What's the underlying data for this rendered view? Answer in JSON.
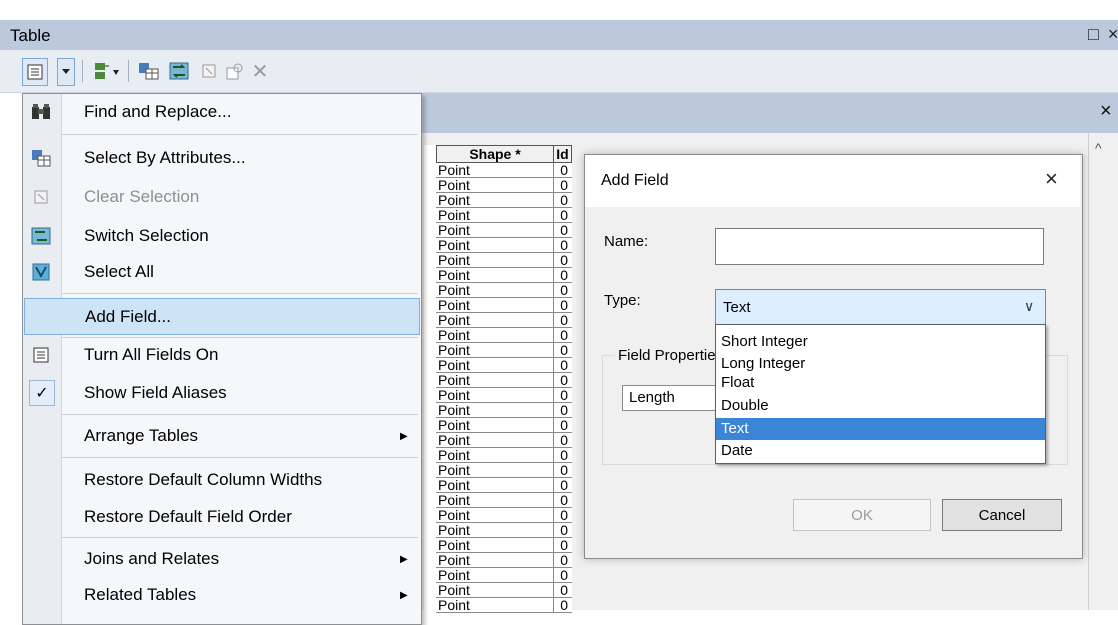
{
  "window": {
    "title": "Table",
    "controls": "□ ×",
    "subbar_close": "×"
  },
  "colors": {
    "titlebar": "#bcc8dc",
    "highlight": "#cde4f7",
    "selected_option": "#3a85d8"
  },
  "toolbar": {
    "icons": [
      "table-options-icon",
      "dropdown-arrow-icon",
      "related-tables-icon",
      "select-by-attributes-icon",
      "switch-selection-icon",
      "clear-selection-icon",
      "zoom-to-selected-icon",
      "delete-selected-icon"
    ]
  },
  "menu": {
    "items": [
      {
        "label": "Find and Replace...",
        "icon": "binoculars-icon",
        "enabled": true
      },
      {
        "label": "Select By Attributes...",
        "icon": "select-by-attributes-icon",
        "enabled": true
      },
      {
        "label": "Clear Selection",
        "icon": "clear-selection-icon",
        "enabled": false
      },
      {
        "label": "Switch Selection",
        "icon": "switch-selection-icon",
        "enabled": true
      },
      {
        "label": "Select All",
        "icon": "select-all-icon",
        "enabled": true
      },
      {
        "label": "Add Field...",
        "icon": "",
        "enabled": true,
        "highlighted": true
      },
      {
        "label": "Turn All Fields On",
        "icon": "fields-on-icon",
        "enabled": true
      },
      {
        "label": "Show Field Aliases",
        "icon": "checkmark-icon",
        "enabled": true,
        "checked": true
      },
      {
        "label": "Arrange Tables",
        "icon": "",
        "enabled": true,
        "submenu": true
      },
      {
        "label": "Restore Default Column Widths",
        "icon": "",
        "enabled": true
      },
      {
        "label": "Restore Default Field Order",
        "icon": "",
        "enabled": true
      },
      {
        "label": "Joins and Relates",
        "icon": "",
        "enabled": true,
        "submenu": true
      },
      {
        "label": "Related Tables",
        "icon": "",
        "enabled": true,
        "submenu": true
      }
    ]
  },
  "table": {
    "columns": [
      "Shape *",
      "Id"
    ],
    "rows": [
      [
        "Point",
        "0"
      ],
      [
        "Point",
        "0"
      ],
      [
        "Point",
        "0"
      ],
      [
        "Point",
        "0"
      ],
      [
        "Point",
        "0"
      ],
      [
        "Point",
        "0"
      ],
      [
        "Point",
        "0"
      ],
      [
        "Point",
        "0"
      ],
      [
        "Point",
        "0"
      ],
      [
        "Point",
        "0"
      ],
      [
        "Point",
        "0"
      ],
      [
        "Point",
        "0"
      ],
      [
        "Point",
        "0"
      ],
      [
        "Point",
        "0"
      ],
      [
        "Point",
        "0"
      ],
      [
        "Point",
        "0"
      ],
      [
        "Point",
        "0"
      ],
      [
        "Point",
        "0"
      ],
      [
        "Point",
        "0"
      ],
      [
        "Point",
        "0"
      ],
      [
        "Point",
        "0"
      ],
      [
        "Point",
        "0"
      ],
      [
        "Point",
        "0"
      ],
      [
        "Point",
        "0"
      ],
      [
        "Point",
        "0"
      ],
      [
        "Point",
        "0"
      ],
      [
        "Point",
        "0"
      ],
      [
        "Point",
        "0"
      ],
      [
        "Point",
        "0"
      ],
      [
        "Point",
        "0"
      ]
    ]
  },
  "dialog": {
    "title": "Add Field",
    "close": "×",
    "name_label": "Name:",
    "name_value": "",
    "type_label": "Type:",
    "type_value": "Text",
    "type_chevron": "∨",
    "field_properties_label": "Field Properties",
    "length_label": "Length",
    "options": [
      "Short Integer",
      "Long Integer",
      "Float",
      "Double",
      "Text",
      "Date"
    ],
    "selected_option": "Text",
    "ok_label": "OK",
    "cancel_label": "Cancel"
  }
}
